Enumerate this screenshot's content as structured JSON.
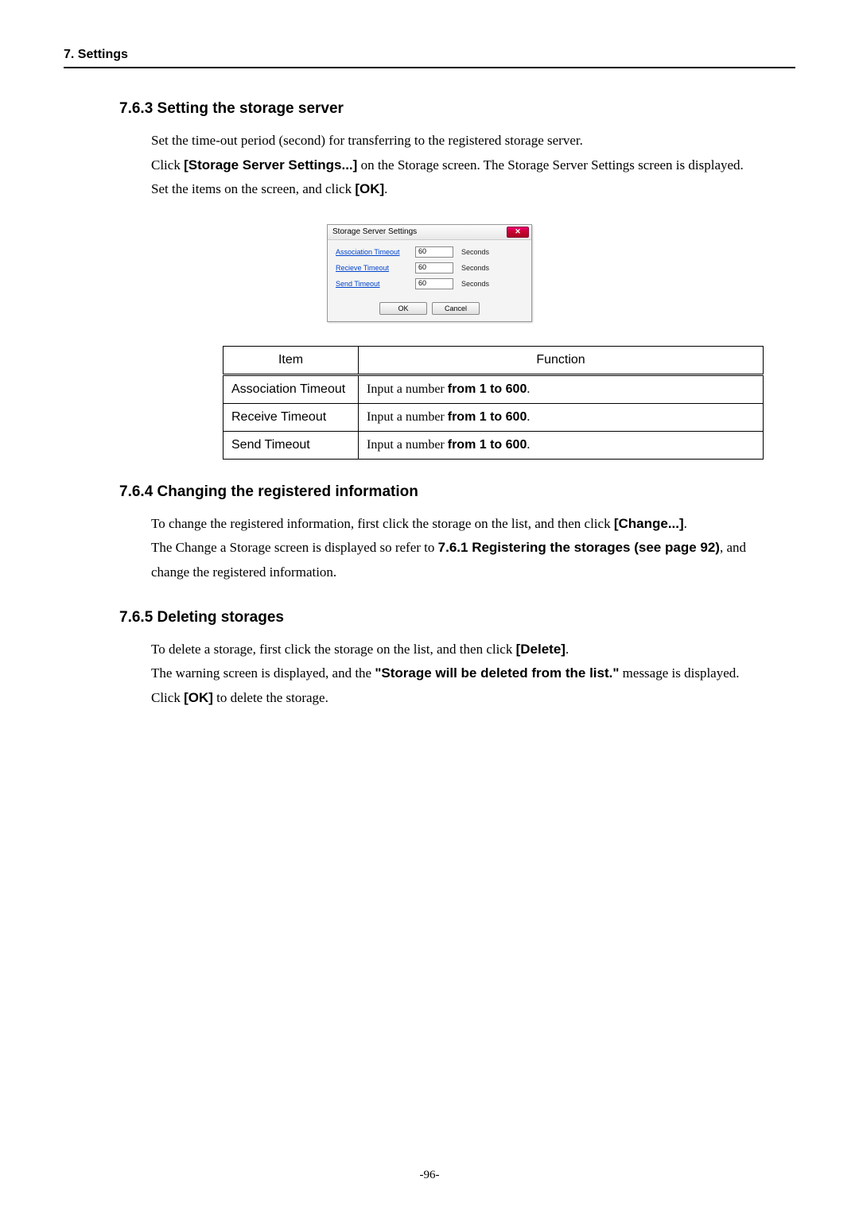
{
  "header": {
    "title": "7. Settings"
  },
  "s763": {
    "heading": "7.6.3 Setting the storage server",
    "p1": "Set the time-out period (second) for transferring to the registered storage server.",
    "p2a": "Click ",
    "p2b": "[Storage Server Settings...]",
    "p2c": " on the Storage screen. The Storage Server Settings screen is displayed.",
    "p3a": "Set the items on the screen, and click ",
    "p3b": "[OK]",
    "p3c": "."
  },
  "dialog": {
    "title": "Storage Server Settings",
    "rows": [
      {
        "label": "Association Timeout",
        "value": "60",
        "unit": "Seconds"
      },
      {
        "label": "Recieve Timeout",
        "value": "60",
        "unit": "Seconds"
      },
      {
        "label": "Send Timeout",
        "value": "60",
        "unit": "Seconds"
      }
    ],
    "ok": "OK",
    "cancel": "Cancel"
  },
  "table": {
    "head_item": "Item",
    "head_func": "Function",
    "rows": [
      {
        "item": "Association Timeout",
        "func_a": "Input a number ",
        "func_b": "from 1 to 600",
        "func_c": "."
      },
      {
        "item": "Receive Timeout",
        "func_a": "Input a number ",
        "func_b": "from 1 to 600",
        "func_c": "."
      },
      {
        "item": "Send Timeout",
        "func_a": "Input a number ",
        "func_b": "from 1 to 600",
        "func_c": "."
      }
    ]
  },
  "s764": {
    "heading": "7.6.4 Changing the registered information",
    "p1a": "To change the registered information, first click the storage on the list, and then click ",
    "p1b": "[Change...]",
    "p1c": ".",
    "p2a": "The Change a Storage screen is displayed so refer to ",
    "p2b": "7.6.1 Registering the storages (see page 92)",
    "p2c": ", and change the registered information."
  },
  "s765": {
    "heading": "7.6.5 Deleting storages",
    "p1a": "To delete a storage, first click the storage on the list, and then click ",
    "p1b": "[Delete]",
    "p1c": ".",
    "p2a": "The warning screen is displayed, and the ",
    "p2b": "\"Storage will be deleted from the list.\"",
    "p2c": " message is displayed.",
    "p3a": "Click ",
    "p3b": "[OK]",
    "p3c": " to delete the storage."
  },
  "page_number": "-96-"
}
